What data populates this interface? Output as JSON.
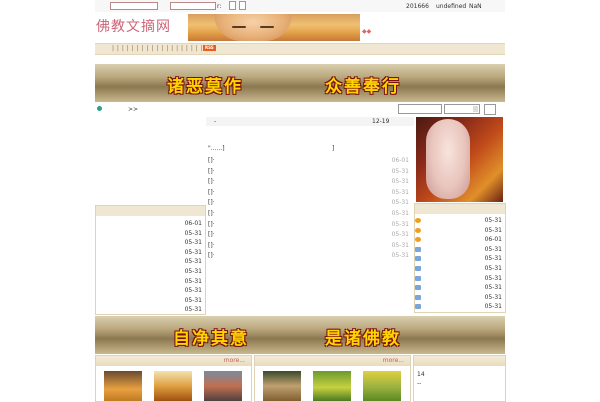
{
  "topbar": {
    "counter": "201666",
    "status1": "undefined",
    "status2": "NaN",
    "colon": "r:"
  },
  "header": {
    "logo": "佛教文摘网",
    "tagline": "◆◆"
  },
  "nav": {
    "text": "| | | | | | | | | | | | | | | | | | | | |",
    "rss": "RSS"
  },
  "banners": {
    "top": [
      "诸恶莫作",
      "众善奉行"
    ],
    "mid": [
      "自净其意",
      "是诸佛教"
    ]
  },
  "search": {
    "arrow": ">>"
  },
  "center": {
    "top_dash": "-",
    "top_date": "12-19",
    "headline": "\"......]",
    "headline_right": "]",
    "rows": [
      {
        "prefix": "[]·",
        "date": "06-01"
      },
      {
        "prefix": "[]·",
        "date": "05-31"
      },
      {
        "prefix": "[]·",
        "date": "05-31"
      },
      {
        "prefix": "[]·",
        "date": "05-31"
      },
      {
        "prefix": "[]·",
        "date": "05-31"
      },
      {
        "prefix": "[]·",
        "date": "05-31"
      },
      {
        "prefix": "[]·",
        "date": "05-31"
      },
      {
        "prefix": "[]·",
        "date": "05-31"
      },
      {
        "prefix": "[]·",
        "date": "05-31"
      },
      {
        "prefix": "[]·",
        "date": "05-31"
      }
    ]
  },
  "left_list": {
    "dates": [
      "06-01",
      "05-31",
      "05-31",
      "05-31",
      "05-31",
      "05-31",
      "05-31",
      "05-31",
      "05-31",
      "05-31"
    ]
  },
  "right_list": {
    "items": [
      {
        "icon": "orange",
        "date": "05-31"
      },
      {
        "icon": "orange",
        "date": "05-31"
      },
      {
        "icon": "orange",
        "date": "06-01"
      },
      {
        "icon": "blue",
        "date": "05-31"
      },
      {
        "icon": "blue",
        "date": "05-31"
      },
      {
        "icon": "blue",
        "date": "05-31"
      },
      {
        "icon": "blue",
        "date": "05-31"
      },
      {
        "icon": "blue",
        "date": "05-31"
      },
      {
        "icon": "blue",
        "date": "05-31"
      },
      {
        "icon": "blue",
        "date": "05-31"
      }
    ],
    "colors": {
      "orange": "#f0a020",
      "blue": "#7aa6d8"
    }
  },
  "bottom": {
    "more1": "more...",
    "more2": "more...",
    "right_num": "14",
    "right_dash": "--"
  }
}
